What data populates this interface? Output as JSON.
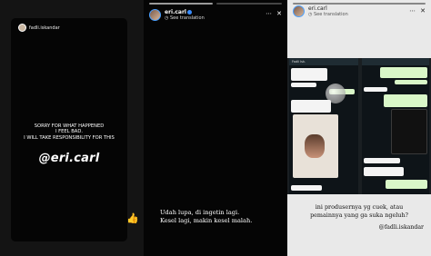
{
  "panel1": {
    "username": "fadli.iskandar",
    "lines": [
      "SORRY FOR WHAT HAPPENED",
      "I FEEL BAD.",
      "I WILL TAKE RESPONSIBILITY FOR THIS"
    ],
    "handle": "@eri.carl",
    "emoji": "👍"
  },
  "panel2": {
    "username": "eri.carl",
    "see_translation": "See translation",
    "caption_lines": [
      "Udah lupa, di ingetin lagi.",
      "Kesel lagi, makin kesel malah."
    ]
  },
  "panel3": {
    "username": "eri.carl",
    "see_translation": "See translation",
    "chat_header": "Fadli Isk.",
    "caption_lines": [
      "ini produsernya yg cuek, atau",
      "pemainnya yang ga suka ngeluh?"
    ],
    "credit": "@fadli.iskandar"
  },
  "icons": {
    "more": "more-icon",
    "close": "close-icon",
    "verified": "verified-badge-icon"
  }
}
